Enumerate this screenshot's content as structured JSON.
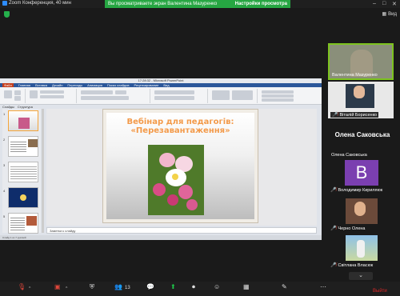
{
  "window": {
    "title": "Zoom Конференция, 40 мин"
  },
  "share_banner": {
    "message": "Вы просматриваете экран Валентина Мазуренко",
    "view_options": "Настройки просмотра"
  },
  "view_button": {
    "label": "Вид"
  },
  "powerpoint": {
    "window_title": "17:28:32 - Microsoft PowerPoint",
    "menu": [
      "Файл",
      "Главная",
      "Вставка",
      "Дизайн",
      "Переходы",
      "Анимация",
      "Показ слайдов",
      "Рецензирование",
      "Вид"
    ],
    "panel_tabs": [
      "Слайды",
      "Структура"
    ],
    "slide_title": "Вебінар для педагогів: «Перезавантаження»",
    "notes_placeholder": "Заметки к слайду",
    "status_text": "Слайд 1 из 7   русский",
    "thumb_numbers": [
      "1",
      "2",
      "3",
      "4",
      "5"
    ]
  },
  "participants": [
    {
      "name": "Валентина Мазуренко",
      "active": true
    },
    {
      "name": "Віталій Борисенко",
      "muted": true
    },
    {
      "name": "Олена Саковська",
      "muted": false,
      "big_label": "Олена Саковська"
    },
    {
      "name": "Володимир Кириляюк",
      "muted": true,
      "initial": "B"
    },
    {
      "name": "Черно Олена",
      "muted": true
    },
    {
      "name": "Світлана Власюк",
      "muted": true
    }
  ],
  "toolbar": {
    "participants_count": "13",
    "leave_label": "Выйти"
  }
}
